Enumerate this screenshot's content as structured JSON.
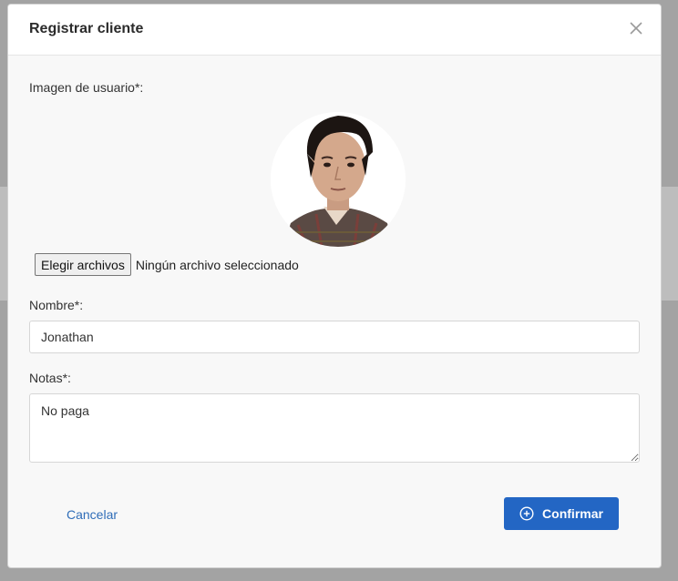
{
  "modal": {
    "title": "Registrar cliente",
    "close_icon": "close-icon"
  },
  "image_field": {
    "label": "Imagen de usuario*:",
    "file_button_label": "Elegir archivos",
    "file_status": "Ningún archivo seleccionado"
  },
  "name_field": {
    "label": "Nombre*:",
    "value": "Jonathan"
  },
  "notes_field": {
    "label": "Notas*:",
    "value": "No paga"
  },
  "actions": {
    "cancel_label": "Cancelar",
    "confirm_label": "Confirmar",
    "confirm_icon": "plus-circle-icon"
  },
  "colors": {
    "primary": "#2366c4",
    "link": "#2f6db8",
    "modal_bg": "#f8f8f8",
    "header_bg": "#ffffff"
  }
}
